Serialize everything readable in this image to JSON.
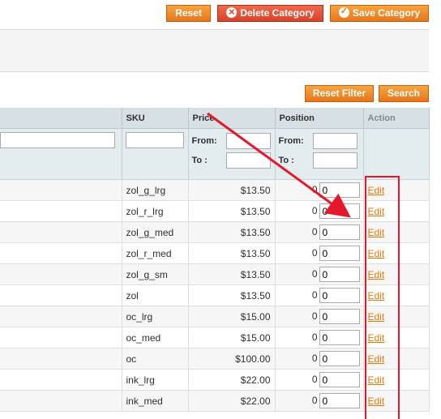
{
  "toolbar": {
    "reset_label": "Reset",
    "delete_label": "Delete Category",
    "save_label": "Save Category"
  },
  "grid_buttons": {
    "reset_filter_label": "Reset Filter",
    "search_label": "Search"
  },
  "columns": {
    "sku": "SKU",
    "price": "Price",
    "position": "Position",
    "action": "Action"
  },
  "filter": {
    "from_label": "From:",
    "to_label": "To :"
  },
  "rows": [
    {
      "sku": "zol_g_lrg",
      "price": "$13.50",
      "position": "0",
      "position_input": "0",
      "action": "Edit"
    },
    {
      "sku": "zol_r_lrg",
      "price": "$13.50",
      "position": "0",
      "position_input": "0",
      "action": "Edit"
    },
    {
      "sku": "zol_g_med",
      "price": "$13.50",
      "position": "0",
      "position_input": "0",
      "action": "Edit"
    },
    {
      "sku": "zol_r_med",
      "price": "$13.50",
      "position": "0",
      "position_input": "0",
      "action": "Edit"
    },
    {
      "sku": "zol_g_sm",
      "price": "$13.50",
      "position": "0",
      "position_input": "0",
      "action": "Edit"
    },
    {
      "sku": "zol",
      "price": "$13.50",
      "position": "0",
      "position_input": "0",
      "action": "Edit"
    },
    {
      "sku": "oc_lrg",
      "price": "$15.00",
      "position": "0",
      "position_input": "0",
      "action": "Edit"
    },
    {
      "sku": "oc_med",
      "price": "$15.00",
      "position": "0",
      "position_input": "0",
      "action": "Edit"
    },
    {
      "sku": "oc",
      "price": "$100.00",
      "position": "0",
      "position_input": "0",
      "action": "Edit"
    },
    {
      "sku": "ink_lrg",
      "price": "$22.00",
      "position": "0",
      "position_input": "0",
      "action": "Edit"
    },
    {
      "sku": "ink_med",
      "price": "$22.00",
      "position": "0",
      "position_input": "0",
      "action": "Edit"
    }
  ],
  "annotation": {
    "arrow_color": "#e4182a",
    "highlight_color": "#e4182a"
  },
  "colors": {
    "button_orange": "#e8761b",
    "button_red": "#d9432a",
    "header_bg": "#d7e1e5",
    "link": "#ea7601"
  }
}
